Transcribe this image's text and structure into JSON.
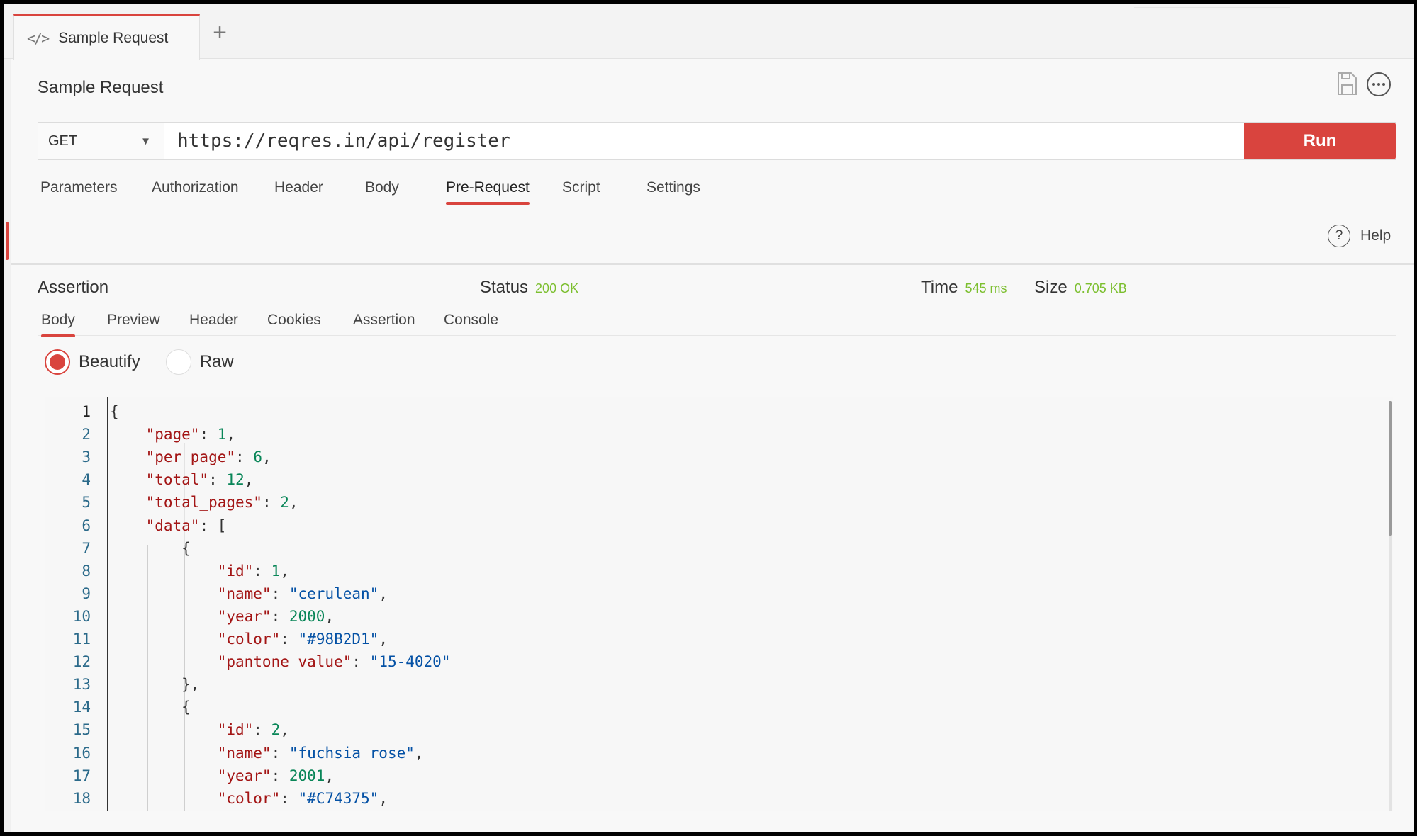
{
  "tabs": [
    {
      "label": "Sample Request",
      "icon": "code-icon"
    }
  ],
  "request": {
    "title": "Sample Request",
    "method": "GET",
    "url": "https://reqres.in/api/register",
    "run_label": "Run",
    "tabs": [
      "Parameters",
      "Authorization",
      "Header",
      "Body",
      "Pre-Request",
      "Script",
      "Settings"
    ],
    "active_tab": "Pre-Request",
    "help_label": "Help"
  },
  "response": {
    "title": "Assertion",
    "status_label": "Status",
    "status_value": "200 OK",
    "time_label": "Time",
    "time_value": "545 ms",
    "size_label": "Size",
    "size_value": "0.705 KB",
    "tabs": [
      "Body",
      "Preview",
      "Header",
      "Cookies",
      "Assertion",
      "Console"
    ],
    "active_tab": "Body",
    "view_options": [
      {
        "label": "Beautify",
        "selected": true
      },
      {
        "label": "Raw",
        "selected": false
      }
    ],
    "code_lines": [
      {
        "n": "1",
        "text": "{"
      },
      {
        "n": "2",
        "text": "    \"page\": 1,"
      },
      {
        "n": "3",
        "text": "    \"per_page\": 6,"
      },
      {
        "n": "4",
        "text": "    \"total\": 12,"
      },
      {
        "n": "5",
        "text": "    \"total_pages\": 2,"
      },
      {
        "n": "6",
        "text": "    \"data\": ["
      },
      {
        "n": "7",
        "text": "        {"
      },
      {
        "n": "8",
        "text": "            \"id\": 1,"
      },
      {
        "n": "9",
        "text": "            \"name\": \"cerulean\","
      },
      {
        "n": "10",
        "text": "            \"year\": 2000,"
      },
      {
        "n": "11",
        "text": "            \"color\": \"#98B2D1\","
      },
      {
        "n": "12",
        "text": "            \"pantone_value\": \"15-4020\""
      },
      {
        "n": "13",
        "text": "        },"
      },
      {
        "n": "14",
        "text": "        {"
      },
      {
        "n": "15",
        "text": "            \"id\": 2,"
      },
      {
        "n": "16",
        "text": "            \"name\": \"fuchsia rose\","
      },
      {
        "n": "17",
        "text": "            \"year\": 2001,"
      },
      {
        "n": "18",
        "text": "            \"color\": \"#C74375\","
      }
    ]
  },
  "colors": {
    "accent": "#d9443e",
    "status_ok": "#7cbf2f",
    "json_key": "#a31515",
    "json_number": "#098658",
    "json_string": "#0451a5"
  }
}
